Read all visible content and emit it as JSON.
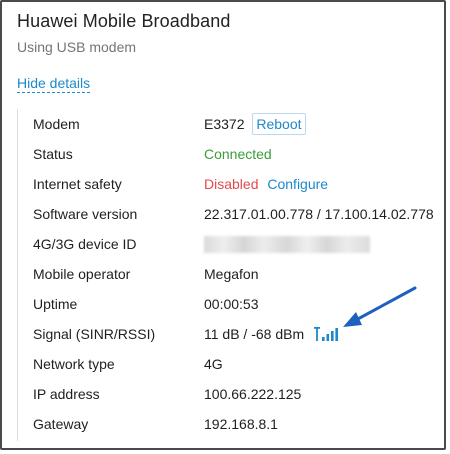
{
  "panel": {
    "title": "Huawei Mobile Broadband",
    "subtitle": "Using USB modem",
    "hide_details_label": "Hide details"
  },
  "rows": [
    {
      "label": "Modem",
      "value": "E3372",
      "action": "Reboot"
    },
    {
      "label": "Status",
      "value": "Connected"
    },
    {
      "label": "Internet safety",
      "value": "Disabled",
      "action": "Configure"
    },
    {
      "label": "Software version",
      "value": "22.317.01.00.778 / 17.100.14.02.778"
    },
    {
      "label": "4G/3G device ID",
      "value": ""
    },
    {
      "label": "Mobile operator",
      "value": "Megafon"
    },
    {
      "label": "Uptime",
      "value": "00:00:53"
    },
    {
      "label": "Signal (SINR/RSSI)",
      "value": "11 dB / -68 dBm"
    },
    {
      "label": "Network type",
      "value": "4G"
    },
    {
      "label": "IP address",
      "value": "100.66.222.125"
    },
    {
      "label": "Gateway",
      "value": "192.168.8.1"
    }
  ],
  "signal": {
    "icon": "signal-strength-icon",
    "bars": 4,
    "color": "#1e88c9"
  },
  "colors": {
    "accent": "#1e88c9",
    "connected": "#3a9d3a",
    "disabled": "#e24a4a",
    "annotation_arrow": "#1f5fbf"
  }
}
